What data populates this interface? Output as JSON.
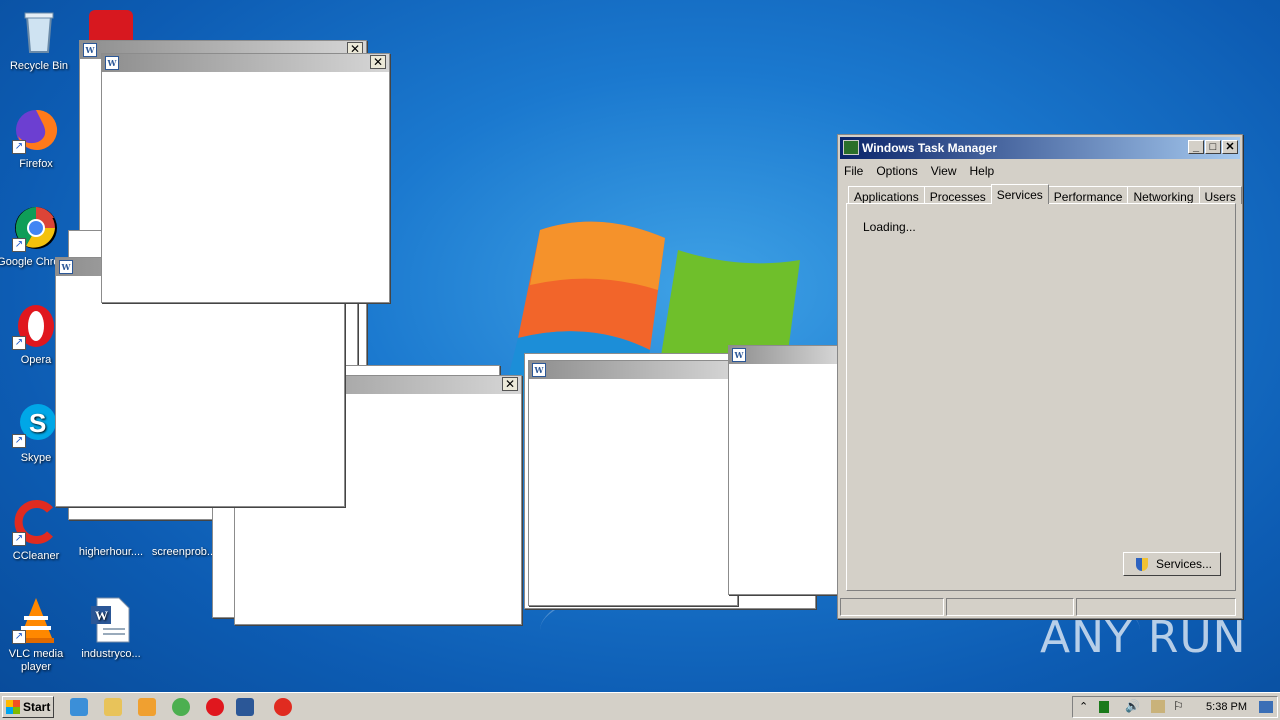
{
  "desktop": {
    "icons": [
      {
        "label": "Recycle Bin",
        "icon": "recycle-bin-icon"
      },
      {
        "label": "Firefox",
        "icon": "firefox-icon"
      },
      {
        "label": "Google Chrome",
        "icon": "chrome-icon"
      },
      {
        "label": "Opera",
        "icon": "opera-icon"
      },
      {
        "label": "Skype",
        "icon": "skype-icon"
      },
      {
        "label": "CCleaner",
        "icon": "ccleaner-icon"
      },
      {
        "label": "VLC media player",
        "icon": "vlc-icon"
      },
      {
        "label": "higherhour....",
        "icon": "file-icon"
      },
      {
        "label": "screenprob...",
        "icon": "file-icon"
      },
      {
        "label": "industryco...",
        "icon": "word-doc-icon"
      }
    ]
  },
  "task_manager": {
    "title": "Windows Task Manager",
    "menu": [
      "File",
      "Options",
      "View",
      "Help"
    ],
    "tabs": [
      "Applications",
      "Processes",
      "Services",
      "Performance",
      "Networking",
      "Users"
    ],
    "active_tab": "Services",
    "loading_text": "Loading...",
    "services_button": "Services..."
  },
  "taskbar": {
    "start_label": "Start",
    "clock": "5:38 PM"
  },
  "watermark": "ANY RUN",
  "colors": {
    "desktop_bg": "#1b79cf",
    "titlebar_active": "#0a246a",
    "dialog_bg": "#d4d0c8"
  }
}
